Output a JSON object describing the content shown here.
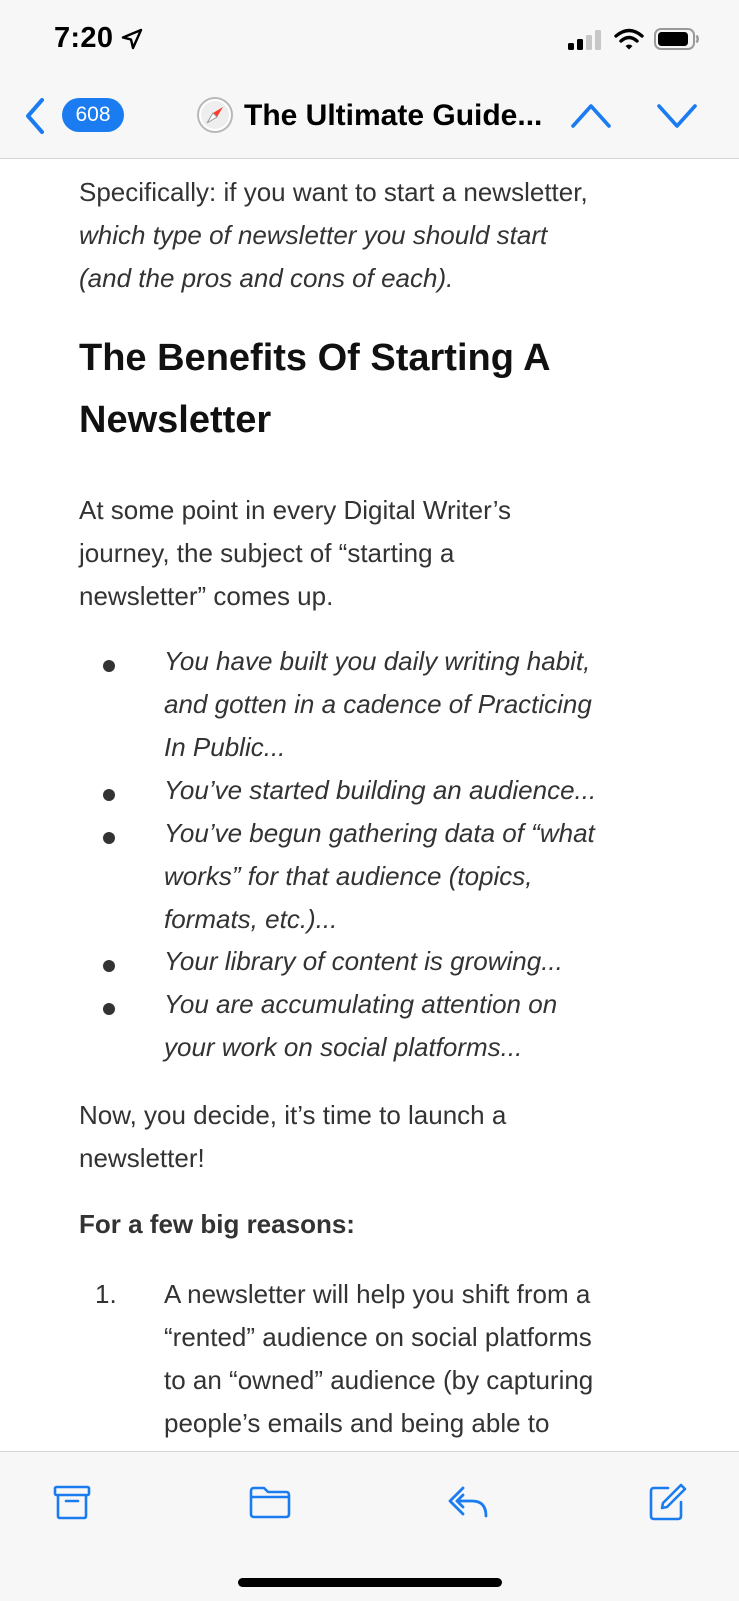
{
  "status_bar": {
    "time": "7:20",
    "icons": [
      "location-arrow-icon",
      "signal-icon",
      "wifi-icon",
      "battery-icon"
    ]
  },
  "nav": {
    "back_icon": "chevron-left-icon",
    "count": "608",
    "app_icon": "compass-icon",
    "title": "The Ultimate Guide...",
    "prev_icon": "chevron-up-icon",
    "next_icon": "chevron-down-icon",
    "accent": "#1a7cf0"
  },
  "content": {
    "intro_line1": "Specifically: if you want to start a newsletter,",
    "intro_line2": "which type of newsletter you should start",
    "intro_line3": "(and the pros and cons of each).",
    "heading_line1": "The Benefits Of Starting A",
    "heading_line2": "Newsletter",
    "para1_line1": "At some point in every Digital Writer’s",
    "para1_line2": "journey, the subject of “starting a",
    "para1_line3": "newsletter” comes up.",
    "bullets": [
      {
        "lines": [
          "You have built you daily writing habit,",
          "and gotten in a cadence of Practicing",
          "In Public..."
        ]
      },
      {
        "lines": [
          "You’ve started building an audience..."
        ]
      },
      {
        "lines": [
          "You’ve begun gathering data of “what",
          "works” for that audience (topics,",
          "formats, etc.)..."
        ]
      },
      {
        "lines": [
          "Your library of content is growing..."
        ]
      },
      {
        "lines": [
          "You are accumulating attention on",
          "your work on social platforms..."
        ]
      }
    ],
    "para2_line1": "Now, you decide, it’s time to launch a",
    "para2_line2": "newsletter!",
    "reasons_heading": "For a few big reasons:",
    "numbered": [
      {
        "num": "1.",
        "lines": [
          "A newsletter will help you shift from a",
          "“rented” audience on social platforms",
          "to an “owned” audience (by capturing",
          "people’s emails and being able to"
        ]
      }
    ]
  },
  "toolbar": {
    "icons": [
      "archive-icon",
      "folder-icon",
      "reply-icon",
      "compose-icon"
    ]
  }
}
